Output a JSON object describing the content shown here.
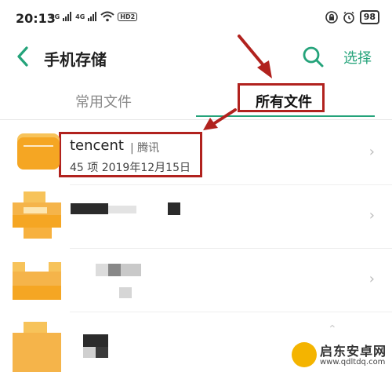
{
  "status_bar": {
    "time": "20:13",
    "signal_labels": [
      "4G",
      "4G"
    ],
    "hd_label": "HD2",
    "battery": "98"
  },
  "header": {
    "title": "手机存储",
    "select_label": "选择"
  },
  "tabs": [
    {
      "label": "常用文件",
      "active": false
    },
    {
      "label": "所有文件",
      "active": true
    }
  ],
  "list": [
    {
      "name": "tencent",
      "tag": "| 腾讯",
      "meta": "45 项  2019年12月15日"
    }
  ],
  "watermark": {
    "text": "启东安卓网",
    "url": "www.qdltdq.com"
  },
  "colors": {
    "accent": "#24a37a",
    "folder": "#f5a623",
    "annotation": "#b1221e"
  },
  "icons": [
    "back-arrow-icon",
    "search-icon",
    "chevron-right-icon",
    "folder-icon",
    "wifi-icon",
    "lock-icon",
    "alarm-icon",
    "battery-icon"
  ]
}
